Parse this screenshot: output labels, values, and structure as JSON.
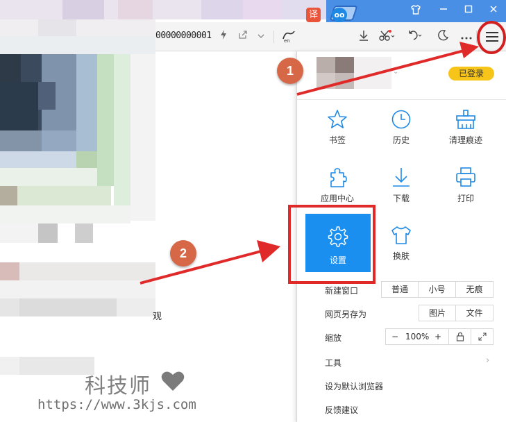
{
  "browser": {
    "address_text": "00000000001",
    "translate_icon_label": "译"
  },
  "menu": {
    "login_badge": "已登录",
    "tiles_row1": [
      "书签",
      "历史",
      "清理痕迹"
    ],
    "tiles_row2": [
      "应用中心",
      "下载",
      "打印"
    ],
    "tiles_row3": [
      "设置",
      "换肤"
    ],
    "new_window": {
      "label": "新建窗口",
      "options": [
        "普通",
        "小号",
        "无痕"
      ]
    },
    "save_page": {
      "label": "网页另存为",
      "options": [
        "图片",
        "文件"
      ]
    },
    "zoom": {
      "label": "缩放",
      "minus": "−",
      "value": "100%",
      "plus": "+"
    },
    "tools_label": "工具",
    "default_browser_label": "设为默认浏览器",
    "feedback_label": "反馈建议"
  },
  "annotations": {
    "step1": "1",
    "step2": "2",
    "arrow_color": "#e02a2a",
    "badge_color": "#d66848"
  },
  "page": {
    "fragment_text": "观"
  },
  "watermark": {
    "title": "科技师",
    "url": "https://www.3kjs.com"
  },
  "colors": {
    "titlebar": "#4a8fe6",
    "active_tile": "#1a8ff0",
    "login_badge": "#f7c41a",
    "icon_blue": "#1e88e5"
  }
}
